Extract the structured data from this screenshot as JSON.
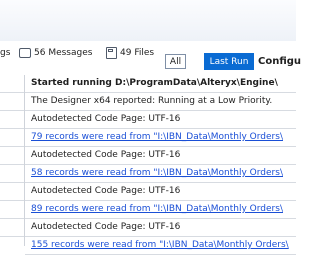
{
  "toolbar": {
    "messages_partial": "gs",
    "messages_count": "56 Messages",
    "files_count": "49 Files",
    "all_label": "All",
    "last_run_label": "Last Run",
    "configure_label": "Configu"
  },
  "log_rows": [
    {
      "text": "Started running D:\\ProgramData\\Alteryx\\Engine\\",
      "style": "bold"
    },
    {
      "text": "The Designer x64 reported: Running at a Low Priority.",
      "style": "plain"
    },
    {
      "text": "Autodetected Code Page: UTF-16",
      "style": "plain"
    },
    {
      "text": "79 records were read from \"I:\\IBN_Data\\Monthly Orders\\",
      "style": "link"
    },
    {
      "text": "Autodetected Code Page: UTF-16",
      "style": "plain"
    },
    {
      "text": "58 records were read from \"I:\\IBN_Data\\Monthly Orders\\",
      "style": "link"
    },
    {
      "text": "Autodetected Code Page: UTF-16",
      "style": "plain"
    },
    {
      "text": "89 records were read from \"I:\\IBN_Data\\Monthly Orders\\",
      "style": "link"
    },
    {
      "text": "Autodetected Code Page: UTF-16",
      "style": "plain"
    },
    {
      "text": "155 records were read from \"I:\\IBN_Data\\Monthly Orders\\",
      "style": "link"
    }
  ]
}
